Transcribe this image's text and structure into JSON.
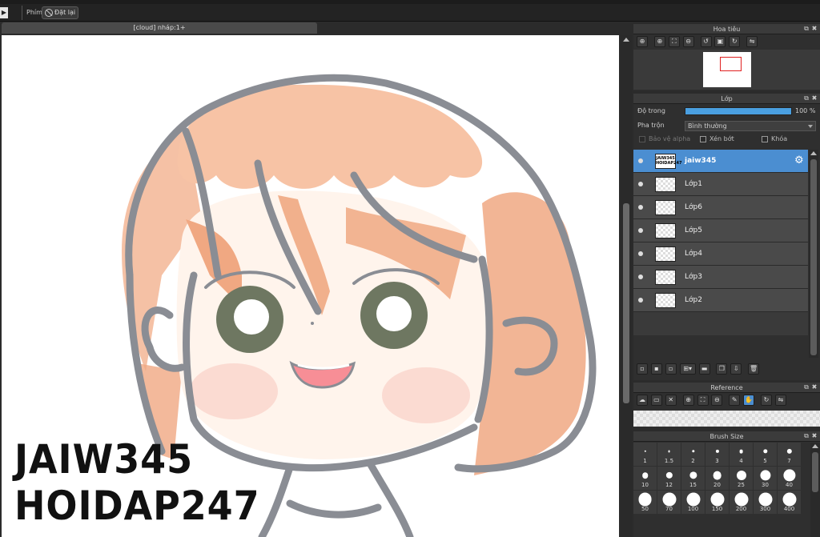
{
  "toolbar": {
    "keys_label": "Phím",
    "reset_label": "Đặt lại"
  },
  "document": {
    "tab_title": "[cloud] nháp:1+"
  },
  "canvas": {
    "watermark_line1": "JAIW345",
    "watermark_line2": "HOIDAP247"
  },
  "navigator": {
    "title": "Hoa tiêu",
    "tools": [
      "zoom-in-icon",
      "zoom-in-icon",
      "fit-icon",
      "zoom-out-icon",
      "rotate-left-icon",
      "fit-window-icon",
      "rotate-right-icon",
      "flip-icon"
    ]
  },
  "layers": {
    "title": "Lớp",
    "opacity_label": "Độ trong",
    "opacity_value": "100 %",
    "opacity_fraction": 1.0,
    "blend_label": "Pha trộn",
    "blend_value": "Bình thường",
    "protect_alpha": "Bảo vệ alpha",
    "clipping": "Xén bớt",
    "lock": "Khóa",
    "selected_thumb_text": "JAIW345 HOIDAP247",
    "items": [
      {
        "name": "jaiw345",
        "selected": true
      },
      {
        "name": "Lớp1",
        "selected": false
      },
      {
        "name": "Lớp6",
        "selected": false
      },
      {
        "name": "Lớp5",
        "selected": false
      },
      {
        "name": "Lớp4",
        "selected": false
      },
      {
        "name": "Lớp3",
        "selected": false
      },
      {
        "name": "Lớp2",
        "selected": false
      }
    ]
  },
  "reference": {
    "title": "Reference"
  },
  "brush_size": {
    "title": "Brush Size",
    "sizes": [
      "1",
      "1.5",
      "2",
      "3",
      "4",
      "5",
      "7",
      "10",
      "12",
      "15",
      "20",
      "25",
      "30",
      "40",
      "50",
      "70",
      "100",
      "150",
      "200",
      "300",
      "400"
    ]
  },
  "colors": {
    "accent": "#4b8ed1",
    "panel_bg": "#2f2f2f",
    "hair": "#f0a882",
    "outline": "#8a8d94",
    "eyes": "#6e7761"
  }
}
